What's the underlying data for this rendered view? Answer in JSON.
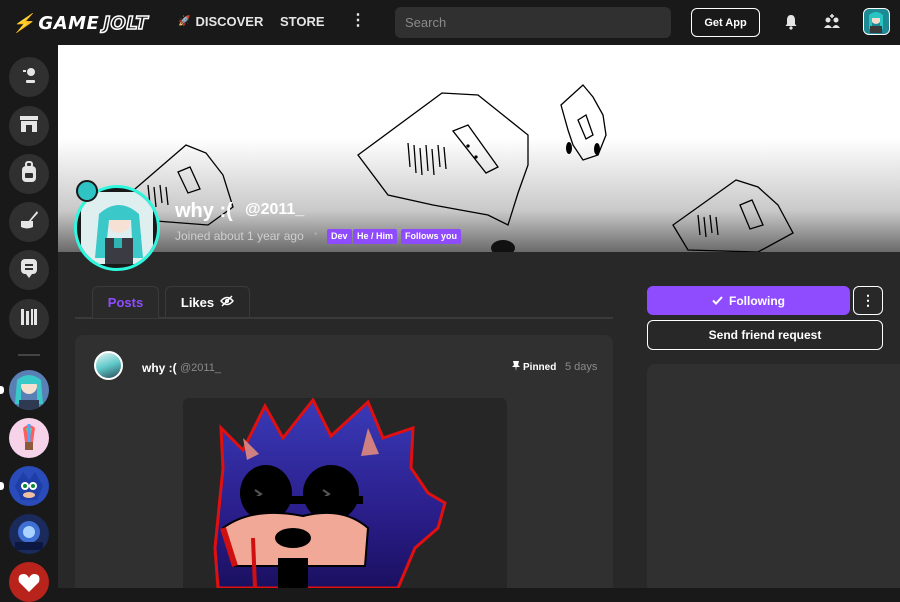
{
  "header": {
    "logo_game": "GAME",
    "logo_jolt": "JOLT",
    "discover_label": "DISCOVER",
    "store_label": "STORE",
    "search_placeholder": "Search",
    "get_app_label": "Get App"
  },
  "profile": {
    "name": "why :(",
    "handle": "@2011_",
    "joined": "Joined about 1 year ago",
    "tags": [
      "Dev",
      "He / Him",
      "Follows you"
    ]
  },
  "tabs": {
    "posts": "Posts",
    "likes": "Likes"
  },
  "actions": {
    "following_label": "Following",
    "friend_request_label": "Send friend request"
  },
  "post": {
    "author_name": "why :(",
    "author_handle": "@2011_",
    "pinned_label": "Pinned",
    "time": "5 days"
  },
  "colors": {
    "accent": "#8f4cff",
    "avatar_ring": "#2ff7de",
    "brand_bolt": "#ccff00",
    "background": "#191919",
    "panel": "#303030"
  }
}
